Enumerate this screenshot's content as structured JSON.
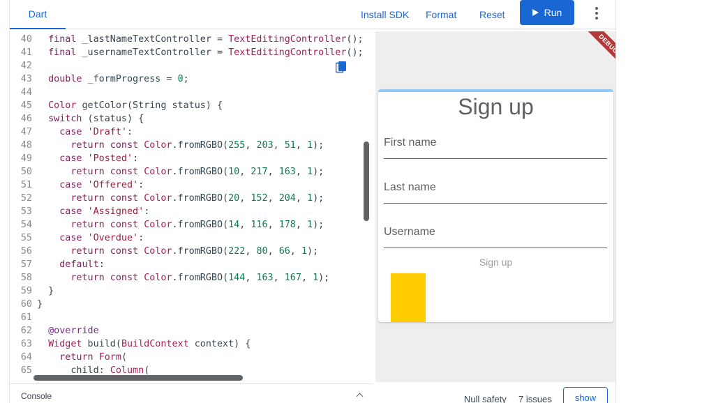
{
  "topbar": {
    "tab_label": "Dart",
    "install_sdk": "Install SDK",
    "format": "Format",
    "reset": "Reset",
    "run": "Run",
    "run_icon": "play-icon",
    "more_icon": "more-vert-icon"
  },
  "editor": {
    "copy_icon": "copy-icon",
    "lines": [
      {
        "n": "40",
        "html": "  <span class='k'>final</span> _lastNameTextController = <span class='ty'>TextEditingController</span>();"
      },
      {
        "n": "41",
        "html": "  <span class='k'>final</span> _usernameTextController = <span class='ty'>TextEditingController</span>();"
      },
      {
        "n": "42",
        "html": ""
      },
      {
        "n": "43",
        "html": "  <span class='k'>double</span> _formProgress = <span class='n'>0</span>;"
      },
      {
        "n": "44",
        "html": ""
      },
      {
        "n": "45",
        "html": "  <span class='ty'>Color</span> getColor(String status) {"
      },
      {
        "n": "46",
        "html": "  <span class='k'>switch</span> (status) {"
      },
      {
        "n": "47",
        "html": "    <span class='k'>case</span> <span class='s'>'Draft'</span>:"
      },
      {
        "n": "48",
        "html": "      <span class='k'>return const</span> <span class='ty'>Color</span>.fromRGBO(<span class='n'>255</span>, <span class='n'>203</span>, <span class='n'>51</span>, <span class='n'>1</span>);"
      },
      {
        "n": "49",
        "html": "    <span class='k'>case</span> <span class='s'>'Posted'</span>:"
      },
      {
        "n": "50",
        "html": "      <span class='k'>return const</span> <span class='ty'>Color</span>.fromRGBO(<span class='n'>10</span>, <span class='n'>217</span>, <span class='n'>163</span>, <span class='n'>1</span>);"
      },
      {
        "n": "51",
        "html": "    <span class='k'>case</span> <span class='s'>'Offered'</span>:"
      },
      {
        "n": "52",
        "html": "      <span class='k'>return const</span> <span class='ty'>Color</span>.fromRGBO(<span class='n'>20</span>, <span class='n'>152</span>, <span class='n'>204</span>, <span class='n'>1</span>);"
      },
      {
        "n": "53",
        "html": "    <span class='k'>case</span> <span class='s'>'Assigned'</span>:"
      },
      {
        "n": "54",
        "html": "      <span class='k'>return const</span> <span class='ty'>Color</span>.fromRGBO(<span class='n'>14</span>, <span class='n'>116</span>, <span class='n'>178</span>, <span class='n'>1</span>);"
      },
      {
        "n": "55",
        "html": "    <span class='k'>case</span> <span class='s'>'Overdue'</span>:"
      },
      {
        "n": "56",
        "html": "      <span class='k'>return const</span> <span class='ty'>Color</span>.fromRGBO(<span class='n'>222</span>, <span class='n'>80</span>, <span class='n'>66</span>, <span class='n'>1</span>);"
      },
      {
        "n": "57",
        "html": "    <span class='k'>default</span>:"
      },
      {
        "n": "58",
        "html": "      <span class='k'>return const</span> <span class='ty'>Color</span>.fromRGBO(<span class='n'>144</span>, <span class='n'>163</span>, <span class='n'>167</span>, <span class='n'>1</span>);"
      },
      {
        "n": "59",
        "html": "  }"
      },
      {
        "n": "60",
        "html": "}"
      },
      {
        "n": "61",
        "html": ""
      },
      {
        "n": "62",
        "html": "  <span class='an'>@override</span>"
      },
      {
        "n": "63",
        "html": "  <span class='ty'>Widget</span> build(<span class='ty'>BuildContext</span> context) {"
      },
      {
        "n": "64",
        "html": "    <span class='k'>return</span> <span class='ty'>Form</span>("
      },
      {
        "n": "65",
        "html": "      child: <span class='ty'>Column</span>("
      }
    ]
  },
  "console": {
    "label": "Console",
    "chevron_icon": "chevron-up-icon"
  },
  "preview": {
    "debug_banner": "DEBUG",
    "title": "Sign up",
    "first_name": "First name",
    "last_name": "Last name",
    "username": "Username",
    "signup_button": "Sign up"
  },
  "status": {
    "null_safety": "Null safety",
    "issues": "7 issues",
    "show": "show"
  },
  "colors": {
    "accent": "#1967d2",
    "yellow": "#ffcc00",
    "progress": "#90caf9",
    "debug": "#b23a3a"
  }
}
